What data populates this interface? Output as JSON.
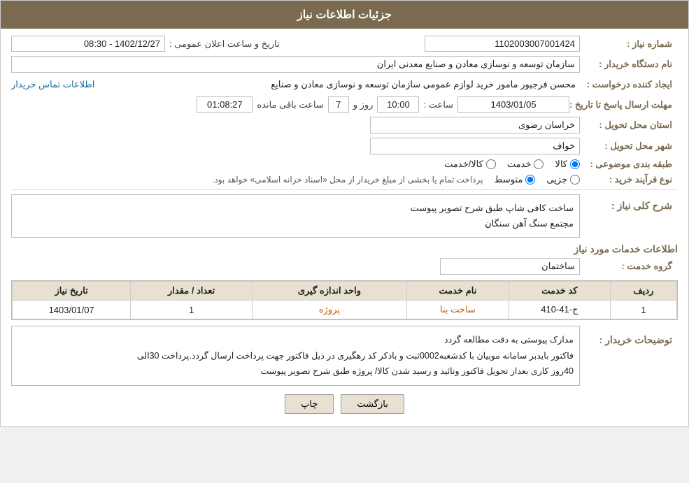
{
  "header": {
    "title": "جزئیات اطلاعات نیاز"
  },
  "fields": {
    "need_number_label": "شماره نیاز :",
    "need_number_value": "1102003007001424",
    "buyer_org_label": "نام دستگاه خریدار :",
    "buyer_org_value": "سازمان توسعه و نوسازی معادن و صنایع معدنی ایران",
    "creator_label": "ایجاد کننده درخواست :",
    "creator_value": "محسن فرجپور مامور خرید لوازم عمومی سازمان توسعه و نوسازی معادن و صنایع",
    "creator_link": "اطلاعات تماس خریدار",
    "deadline_label": "مهلت ارسال پاسخ تا تاریخ :",
    "deadline_date": "1403/01/05",
    "deadline_time_label": "ساعت :",
    "deadline_time": "10:00",
    "deadline_day_label": "روز و",
    "deadline_days": "7",
    "deadline_remain_label": "ساعت باقی مانده",
    "deadline_remain": "01:08:27",
    "announce_label": "تاریخ و ساعت اعلان عمومی :",
    "announce_value": "1402/12/27 - 08:30",
    "province_label": "استان محل تحویل :",
    "province_value": "خراسان رضوی",
    "city_label": "شهر محل تحویل :",
    "city_value": "خواف",
    "category_label": "طبقه بندی موضوعی :",
    "category_options": [
      {
        "id": "kala",
        "label": "کالا",
        "checked": true
      },
      {
        "id": "khadamat",
        "label": "خدمت",
        "checked": false
      },
      {
        "id": "kala_khadamat",
        "label": "کالا/خدمت",
        "checked": false
      }
    ],
    "purchase_type_label": "نوع فرآیند خرید :",
    "purchase_options": [
      {
        "id": "jozii",
        "label": "جزیی",
        "checked": false
      },
      {
        "id": "motevasset",
        "label": "متوسط",
        "checked": true
      }
    ],
    "purchase_note": "پرداخت تمام یا بخشی از مبلغ خریدار از محل «اسناد خزانه اسلامی» خواهد بود.",
    "description_label": "شرح کلی نیاز :",
    "description_value": "ساخت کافی شاپ طبق شرح تصویر پیوست\nمجتمع سنگ آهن سنگان",
    "services_section_title": "اطلاعات خدمات مورد نیاز",
    "service_group_label": "گروه خدمت :",
    "service_group_value": "ساختمان",
    "table": {
      "headers": [
        "ردیف",
        "کد خدمت",
        "نام خدمت",
        "واحد اندازه گیری",
        "تعداد / مقدار",
        "تاریخ نیاز"
      ],
      "rows": [
        {
          "row_num": "1",
          "service_code": "ج-41-410",
          "service_name": "ساخت بنا",
          "unit": "پروژه",
          "qty": "1",
          "date": "1403/01/07"
        }
      ]
    },
    "buyer_notes_label": "توضیحات خریدار :",
    "buyer_notes": "مدارک پیوستی به دقت مطالعه گردد\nفاکتور بایدبر سامانه موبیان با کدشعبه0002ثبت و باذکر کد رهگیری در ذیل فاکتور جهت پرداخت ارسال گردد.پرداخت 30الی\n40روز کاری بعداز تحویل فاکتور وتائید و رسید شدن کالا/ پروژه طبق شرح تصویر پیوست",
    "btn_back": "بازگشت",
    "btn_print": "چاپ"
  }
}
